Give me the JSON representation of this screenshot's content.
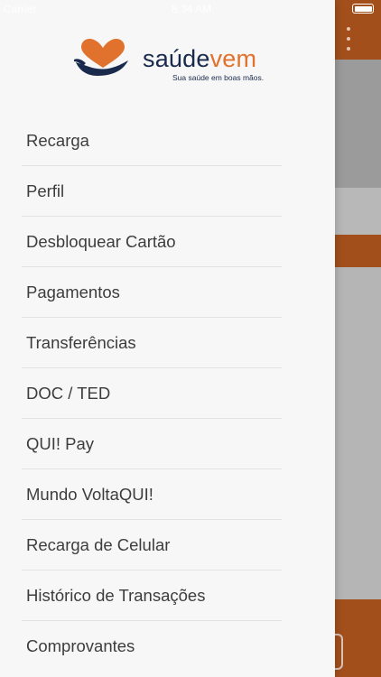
{
  "status_bar": {
    "carrier": "Carrier",
    "time": "8:34 AM"
  },
  "brand": {
    "word_part1": "saúde",
    "word_part2": "vem",
    "tagline": "Sua saúde em boas mãos.",
    "colors": {
      "orange": "#e0722d",
      "navy": "#1a2a4c"
    }
  },
  "menu": {
    "items": [
      {
        "label": "Recarga"
      },
      {
        "label": "Perfil"
      },
      {
        "label": "Desbloquear Cartão"
      },
      {
        "label": "Pagamentos"
      },
      {
        "label": "Transferências"
      },
      {
        "label": "DOC / TED"
      },
      {
        "label": "QUI! Pay"
      },
      {
        "label": "Mundo VoltaQUI!"
      },
      {
        "label": "Recarga de Celular"
      },
      {
        "label": "Histórico de Transações"
      },
      {
        "label": "Comprovantes"
      }
    ]
  },
  "background_app": {
    "accent": "#a24f1c",
    "menu_icon": "kebab-menu-icon"
  }
}
